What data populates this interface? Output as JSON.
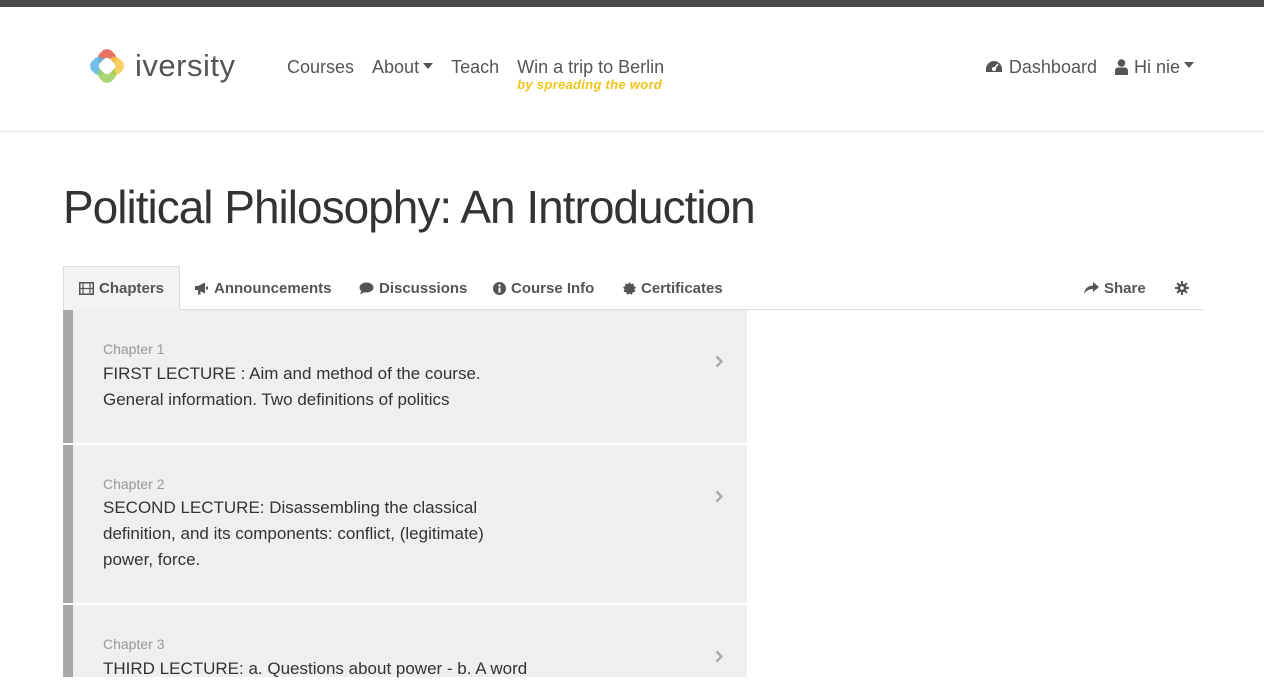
{
  "brand": {
    "name": "iversity"
  },
  "nav": {
    "courses": "Courses",
    "about": "About",
    "teach": "Teach",
    "promo_title": "Win a trip to Berlin",
    "promo_subtitle": "by spreading the word",
    "dashboard": "Dashboard",
    "user_greeting": "Hi nie"
  },
  "course": {
    "title": "Political Philosophy: An Introduction"
  },
  "tabs": {
    "chapters": "Chapters",
    "announcements": "Announcements",
    "discussions": "Discussions",
    "course_info": "Course Info",
    "certificates": "Certificates",
    "share": "Share"
  },
  "chapters": [
    {
      "number": "Chapter 1",
      "title": "FIRST LECTURE : Aim and method of the course. General information. Two definitions of politics"
    },
    {
      "number": "Chapter 2",
      "title": "SECOND LECTURE: Disassembling the classical definition, and its components: conflict, (legitimate) power, force."
    },
    {
      "number": "Chapter 3",
      "title": "THIRD LECTURE: a. Questions about power - b. A word"
    }
  ],
  "colors": {
    "promo": "#f0c419",
    "accent_bar": "#a8a8a8",
    "top_bar": "#4a4a48"
  },
  "icons": [
    "film-icon",
    "bullhorn-icon",
    "comment-icon",
    "info-circle-icon",
    "certificate-icon",
    "share-icon",
    "gear-icon",
    "dashboard-icon",
    "user-icon",
    "chevron-right-icon",
    "caret-down-icon"
  ]
}
